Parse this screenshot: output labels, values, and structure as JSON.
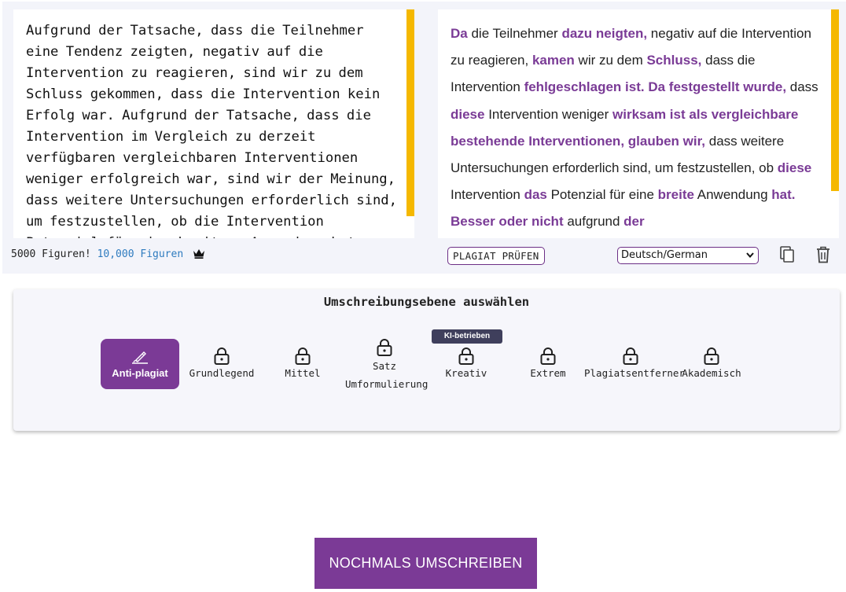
{
  "input": {
    "text": "Aufgrund der Tatsache, dass die Teilnehmer eine Tendenz zeigten, negativ auf die Intervention zu reagieren, sind wir zu dem Schluss gekommen, dass die Intervention kein Erfolg war. Aufgrund der Tatsache, dass die Intervention im Vergleich zu derzeit verfügbaren vergleichbaren Interventionen weniger erfolgreich war, sind wir der Meinung, dass weitere Untersuchungen erforderlich sind, um festzustellen, ob die Intervention Potenzial für eine breitere Anwendung hat, aufgrund dieser geringen Erfolgsrate."
  },
  "output": {
    "segments": [
      {
        "text": "Da",
        "highlight": true
      },
      {
        "text": " die Teilnehmer ",
        "highlight": false
      },
      {
        "text": "dazu neigten,",
        "highlight": true
      },
      {
        "text": " negativ auf die Intervention zu reagieren, ",
        "highlight": false
      },
      {
        "text": "kamen",
        "highlight": true
      },
      {
        "text": " wir zu dem ",
        "highlight": false
      },
      {
        "text": "Schluss,",
        "highlight": true
      },
      {
        "text": " dass die Intervention ",
        "highlight": false
      },
      {
        "text": "fehlgeschlagen ist. Da festgestellt wurde,",
        "highlight": true
      },
      {
        "text": " dass ",
        "highlight": false
      },
      {
        "text": "diese",
        "highlight": true
      },
      {
        "text": " Intervention weniger ",
        "highlight": false
      },
      {
        "text": "wirksam ist als vergleichbare bestehende Interventionen, glauben wir,",
        "highlight": true
      },
      {
        "text": " dass weitere Untersuchungen erforderlich sind, um festzustellen, ob ",
        "highlight": false
      },
      {
        "text": "diese",
        "highlight": true
      },
      {
        "text": " Intervention ",
        "highlight": false
      },
      {
        "text": "das",
        "highlight": true
      },
      {
        "text": " Potenzial für eine ",
        "highlight": false
      },
      {
        "text": "breite",
        "highlight": true
      },
      {
        "text": " Anwendung ",
        "highlight": false
      },
      {
        "text": "hat. Besser oder nicht",
        "highlight": true
      },
      {
        "text": " aufgrund ",
        "highlight": false
      },
      {
        "text": "der",
        "highlight": true
      }
    ]
  },
  "footer": {
    "count_text": "5000 Figuren!",
    "count_link": "10,000 Figuren",
    "crown_icon": "crown-icon",
    "check_button": "PLAGIAT PRÜFEN",
    "language_selected": "Deutsch/German",
    "copy_icon": "copy-icon",
    "trash_icon": "trash-icon"
  },
  "levels": {
    "title": "Umschreibungsebene auswählen",
    "badge": "KI-betrieben",
    "items": [
      {
        "label": "Anti-plagiat",
        "icon": "pen-icon",
        "active": true
      },
      {
        "label": "Grundlegend",
        "icon": "lock-icon",
        "active": false
      },
      {
        "label": "Mittel",
        "icon": "lock-icon",
        "active": false
      },
      {
        "label_line1": "Satz",
        "label_line2": "Umformulierung",
        "icon": "lock-icon",
        "active": false
      },
      {
        "label": "Kreativ",
        "icon": "lock-icon",
        "active": false
      },
      {
        "label": "Extrem",
        "icon": "lock-icon",
        "active": false
      },
      {
        "label": "Plagiatsentferner",
        "icon": "lock-icon",
        "active": false
      },
      {
        "label": "Akademisch",
        "icon": "lock-icon",
        "active": false
      }
    ]
  },
  "actions": {
    "rewrite_again": "NOCHMALS UMSCHREIBEN"
  },
  "colors": {
    "accent": "#7b3a96",
    "scrollbar": "#f5b800",
    "link": "#2e7bbf"
  }
}
